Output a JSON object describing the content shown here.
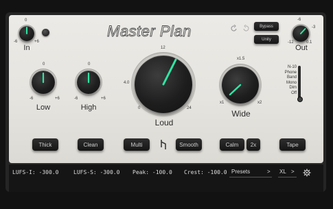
{
  "app": {
    "title": "Master Plan"
  },
  "colors": {
    "accent": "#2ee6a3",
    "panel": "#e8e6e1",
    "footer": "#151515"
  },
  "knobs": {
    "in": {
      "label": "In",
      "min": "-6",
      "max": "+6",
      "top": "0"
    },
    "out": {
      "label": "Out",
      "min": "-12",
      "max": "0.1",
      "t1": "-6",
      "t2": "-3"
    },
    "low": {
      "label": "Low",
      "min": "-6",
      "max": "+6",
      "top": "0"
    },
    "high": {
      "label": "High",
      "min": "-6",
      "max": "+6",
      "top": "0"
    },
    "loud": {
      "label": "Loud",
      "t0": "0",
      "t4": "4.0",
      "t12": "12",
      "t24": "24"
    },
    "wide": {
      "label": "Wide",
      "top": "x1.5",
      "min": "x1",
      "max": "x2"
    }
  },
  "top_buttons": {
    "bypass": "Bypass",
    "unity": "Unity"
  },
  "icons": {
    "undo": "undo-icon",
    "redo": "redo-icon",
    "settings": "gear-icon",
    "logo": "mp-logo-icon",
    "led": "power-led"
  },
  "modes": [
    "N-10",
    "Phone",
    "Band",
    "Mono",
    "Dim",
    "Off"
  ],
  "buttons": {
    "thick": "Thick",
    "clean": "Clean",
    "multi": "Multi",
    "smooth": "Smooth",
    "calm": "Calm",
    "calm2x": "2x",
    "tape": "Tape"
  },
  "footer": {
    "lufs_i": "LUFS-I: -300.0",
    "lufs_s": "LUFS-S: -300.0",
    "peak": "Peak: -100.0",
    "crest": "Crest: -100.0",
    "presets": "Presets",
    "presets_arrow": ">",
    "size": "XL",
    "size_arrow": ">"
  }
}
